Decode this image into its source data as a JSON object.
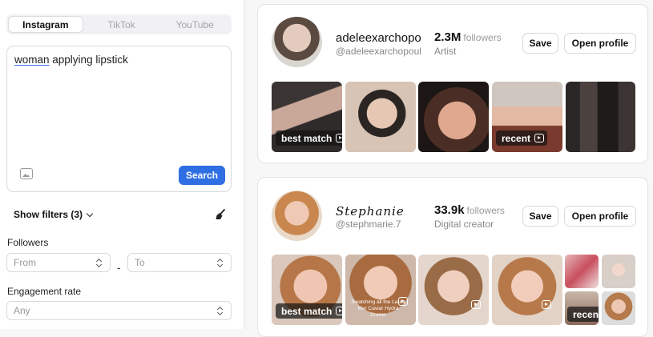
{
  "platform_tabs": [
    "Instagram",
    "TikTok",
    "YouTube"
  ],
  "search": {
    "query_highlight": "woman",
    "query_rest": " applying lipstick",
    "button_label": "Search"
  },
  "filters": {
    "toggle_label": "Show filters (3)",
    "followers_label": "Followers",
    "followers_from": "From",
    "followers_to": "To",
    "range_separator": "-",
    "engagement_label": "Engagement rate",
    "engagement_value": "Any"
  },
  "results": [
    {
      "name": "adeleexarchopoulos",
      "handle": "@adeleexarchopoulos",
      "followers": "2.3M",
      "followers_unit": "followers",
      "role": "Artist",
      "save_label": "Save",
      "open_label": "Open profile",
      "thumb_tags": [
        "best match",
        "recent"
      ]
    },
    {
      "name": "Stephanie",
      "handle": "@stephmarie.7",
      "followers": "33.9k",
      "followers_unit": "followers",
      "role": "Digital creator",
      "save_label": "Save",
      "open_label": "Open profile",
      "thumb_tags": [
        "best match",
        "recent"
      ],
      "thumb_caption": "Swatching all the Laura Mer Caviar Hydra Creme"
    }
  ],
  "colors": {
    "accent": "#2f6fe3",
    "border": "#d9d9de"
  }
}
